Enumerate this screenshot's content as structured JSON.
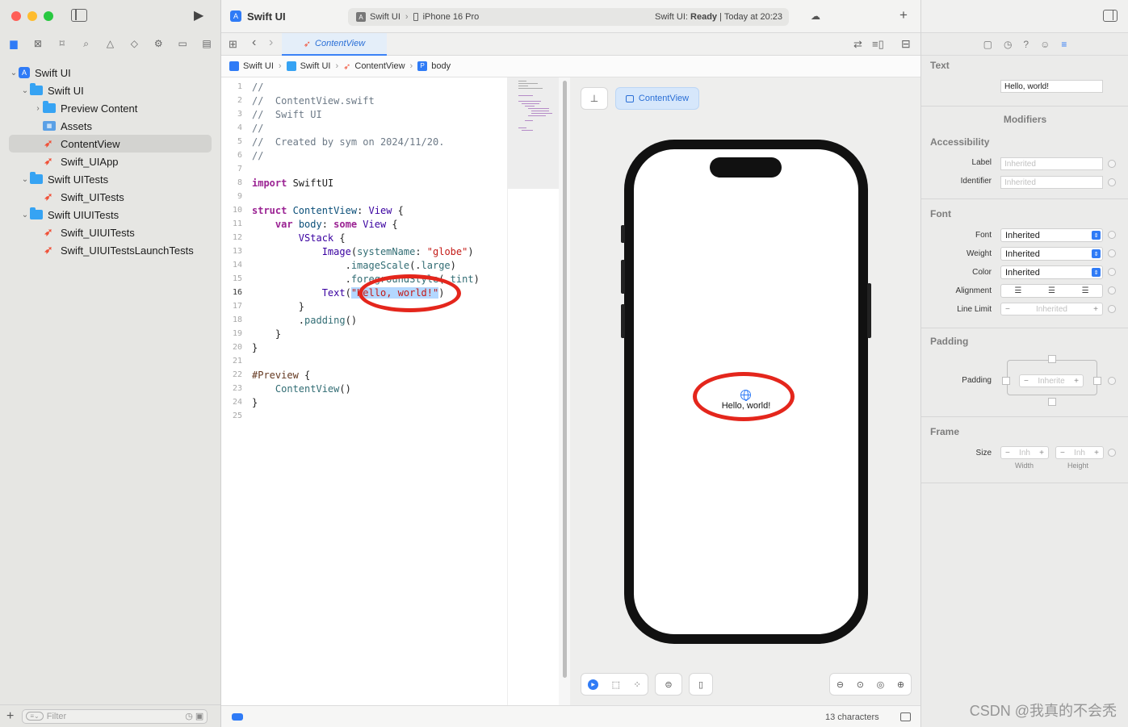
{
  "window": {
    "project_title": "Swift UI",
    "scheme": "Swift UI",
    "device": "iPhone 16 Pro",
    "status_prefix": "Swift UI: ",
    "status_state": "Ready",
    "status_time": "| Today at 20:23"
  },
  "sidebar": {
    "items": [
      {
        "label": "Swift UI"
      },
      {
        "label": "Swift UI"
      },
      {
        "label": "Preview Content"
      },
      {
        "label": "Assets"
      },
      {
        "label": "ContentView"
      },
      {
        "label": "Swift_UIApp"
      },
      {
        "label": "Swift UITests"
      },
      {
        "label": "Swift_UITests"
      },
      {
        "label": "Swift UIUITests"
      },
      {
        "label": "Swift_UIUITests"
      },
      {
        "label": "Swift_UIUITestsLaunchTests"
      }
    ],
    "filter_placeholder": "Filter"
  },
  "tab": {
    "label": "ContentView"
  },
  "jumpbar": {
    "project": "Swift UI",
    "folder": "Swift UI",
    "file": "ContentView",
    "symbol": "body"
  },
  "editor": {
    "line_numbers": [
      "1",
      "2",
      "3",
      "4",
      "5",
      "6",
      "7",
      "8",
      "9",
      "10",
      "11",
      "12",
      "13",
      "14",
      "15",
      "16",
      "17",
      "18",
      "19",
      "20",
      "21",
      "22",
      "23",
      "24",
      "25"
    ],
    "current_line": "16",
    "lines": {
      "l1": "//",
      "l2": "//  ContentView.swift",
      "l3": "//  Swift UI",
      "l4": "//",
      "l5": "//  Created by sym on 2024/11/20.",
      "l6": "//",
      "l8_kw": "import",
      "l8_mod": " SwiftUI",
      "l10_kw": "struct",
      "l10_name": " ContentView",
      "l10_colon": ": ",
      "l10_type": "View",
      "l10_brace": " {",
      "l11_kw": "var",
      "l11_name": " body",
      "l11_colon": ": ",
      "l11_kw2": "some",
      "l11_type": " View",
      "l11_brace": " {",
      "l12_type": "VStack",
      "l12_brace": " {",
      "l13_type": "Image",
      "l13_p1": "(",
      "l13_arg": "systemName",
      "l13_p2": ": ",
      "l13_str": "\"globe\"",
      "l13_p3": ")",
      "l14_dot": ".",
      "l14_fn": "imageScale",
      "l14_p1": "(.",
      "l14_arg": "large",
      "l14_p2": ")",
      "l15_dot": ".",
      "l15_fn": "foregroundStyle",
      "l15_p1": "(.",
      "l15_arg": "tint",
      "l15_p2": ")",
      "l16_type": "Text",
      "l16_p1": "(",
      "l16_str": "\"Hello, world!\"",
      "l16_p2": ")",
      "l17": "}",
      "l18_dot": ".",
      "l18_fn": "padding",
      "l18_p": "()",
      "l19": "}",
      "l20": "}",
      "l22_macro": "#Preview",
      "l22_brace": " {",
      "l23_name": "ContentView",
      "l23_p": "()",
      "l24": "}"
    }
  },
  "canvas": {
    "preview_label": "ContentView",
    "preview_text": "Hello, world!"
  },
  "status": {
    "characters": "13 characters"
  },
  "inspector": {
    "text_title": "Text",
    "text_value": "Hello, world!",
    "modifiers_title": "Modifiers",
    "accessibility_title": "Accessibility",
    "label_label": "Label",
    "label_placeholder": "Inherited",
    "identifier_label": "Identifier",
    "identifier_placeholder": "Inherited",
    "font_title": "Font",
    "font_label": "Font",
    "font_value": "Inherited",
    "weight_label": "Weight",
    "weight_value": "Inherited",
    "color_label": "Color",
    "color_value": "Inherited",
    "alignment_label": "Alignment",
    "linelimit_label": "Line Limit",
    "linelimit_value": "Inherited",
    "padding_title": "Padding",
    "padding_label": "Padding",
    "padding_value": "Inherite",
    "frame_title": "Frame",
    "size_label": "Size",
    "width_value": "Inh",
    "height_value": "Inh",
    "width_caption": "Width",
    "height_caption": "Height"
  },
  "watermark": "CSDN @我真的不会秃",
  "colors": {
    "accent": "#2f7bf6",
    "annotation_red": "#e4261c",
    "swift_orange": "#f05138",
    "folder_blue": "#36a3f3"
  },
  "icons": [
    "sidebar-toggle-icon",
    "run-icon",
    "folder-icon",
    "bookmark-icon",
    "search-icon",
    "warning-icon",
    "plus-icon",
    "swift-file-icon",
    "globe-icon",
    "pin-icon",
    "zoom-in-icon",
    "zoom-out-icon",
    "device-icon",
    "inspector-toggle-icon"
  ]
}
